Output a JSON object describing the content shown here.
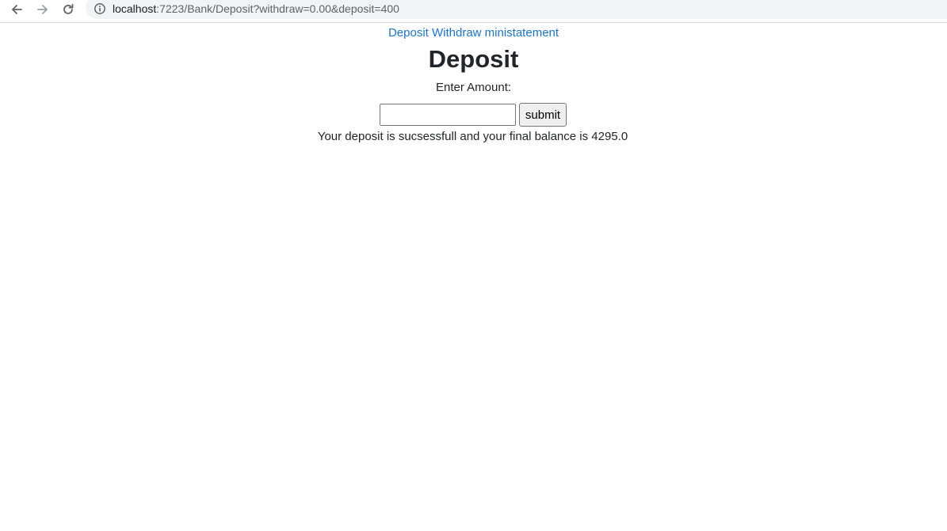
{
  "browser": {
    "url_host": "localhost",
    "url_path": ":7223/Bank/Deposit?withdraw=0.00&deposit=400"
  },
  "nav": {
    "deposit": "Deposit",
    "withdraw": "Withdraw",
    "ministatement": "ministatement"
  },
  "page": {
    "title": "Deposit",
    "amount_label": "Enter Amount:",
    "amount_value": "",
    "submit_label": "submit",
    "result_message": "Your deposit is sucsessfull and your final balance is 4295.0"
  },
  "colors": {
    "link": "#1a73d4",
    "text": "#212529"
  },
  "icons": [
    "back-arrow-icon",
    "forward-arrow-icon",
    "reload-icon",
    "info-icon"
  ]
}
